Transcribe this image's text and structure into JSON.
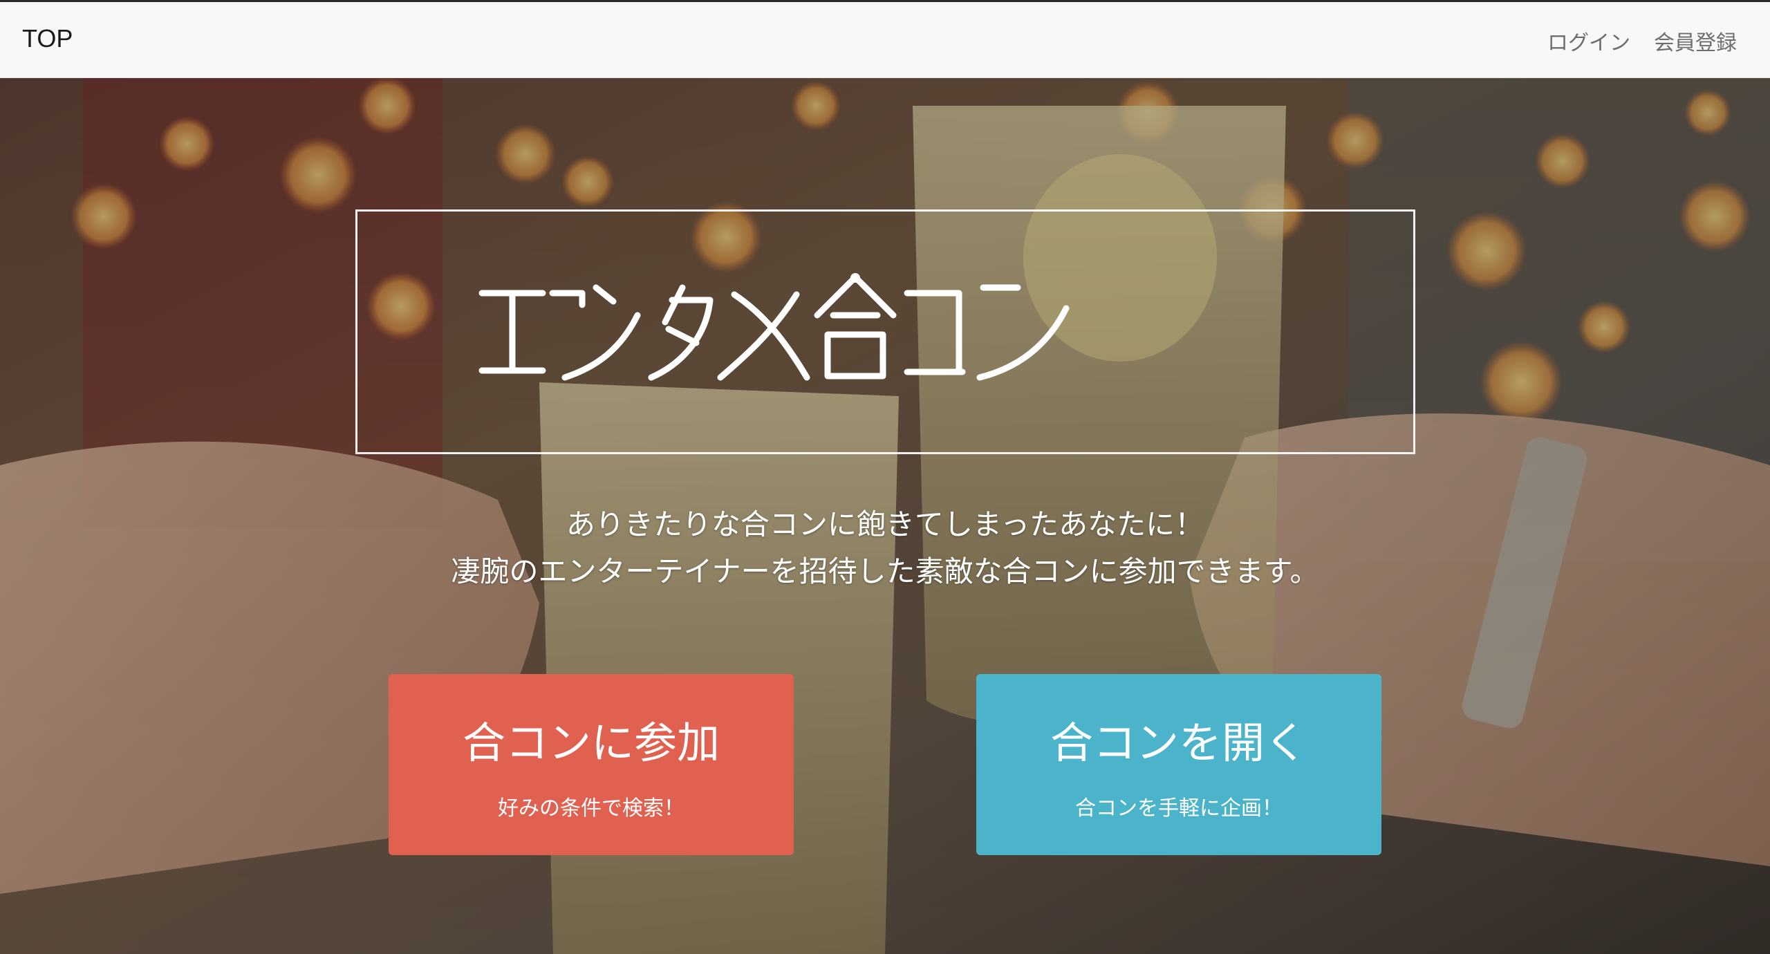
{
  "nav": {
    "brand": "TOP",
    "links": [
      {
        "label": "ログイン"
      },
      {
        "label": "会員登録"
      }
    ]
  },
  "hero": {
    "logo_text": "エンタメ合コン",
    "tagline_lines": [
      "ありきたりな合コンに飽きてしまったあなたに！",
      "凄腕のエンターテイナーを招待した素敵な合コンに参加できます。"
    ]
  },
  "cta": [
    {
      "title": "合コンに参加",
      "subtitle": "好みの条件で検索！",
      "color": "#e16150"
    },
    {
      "title": "合コンを開く",
      "subtitle": "合コンを手軽に企画！",
      "color": "#4bb4cb"
    }
  ],
  "colors": {
    "navbar_bg": "#f7f8f9",
    "join_button": "#e16150",
    "host_button": "#4bb4cb",
    "overlay_text": "#ffffff"
  }
}
